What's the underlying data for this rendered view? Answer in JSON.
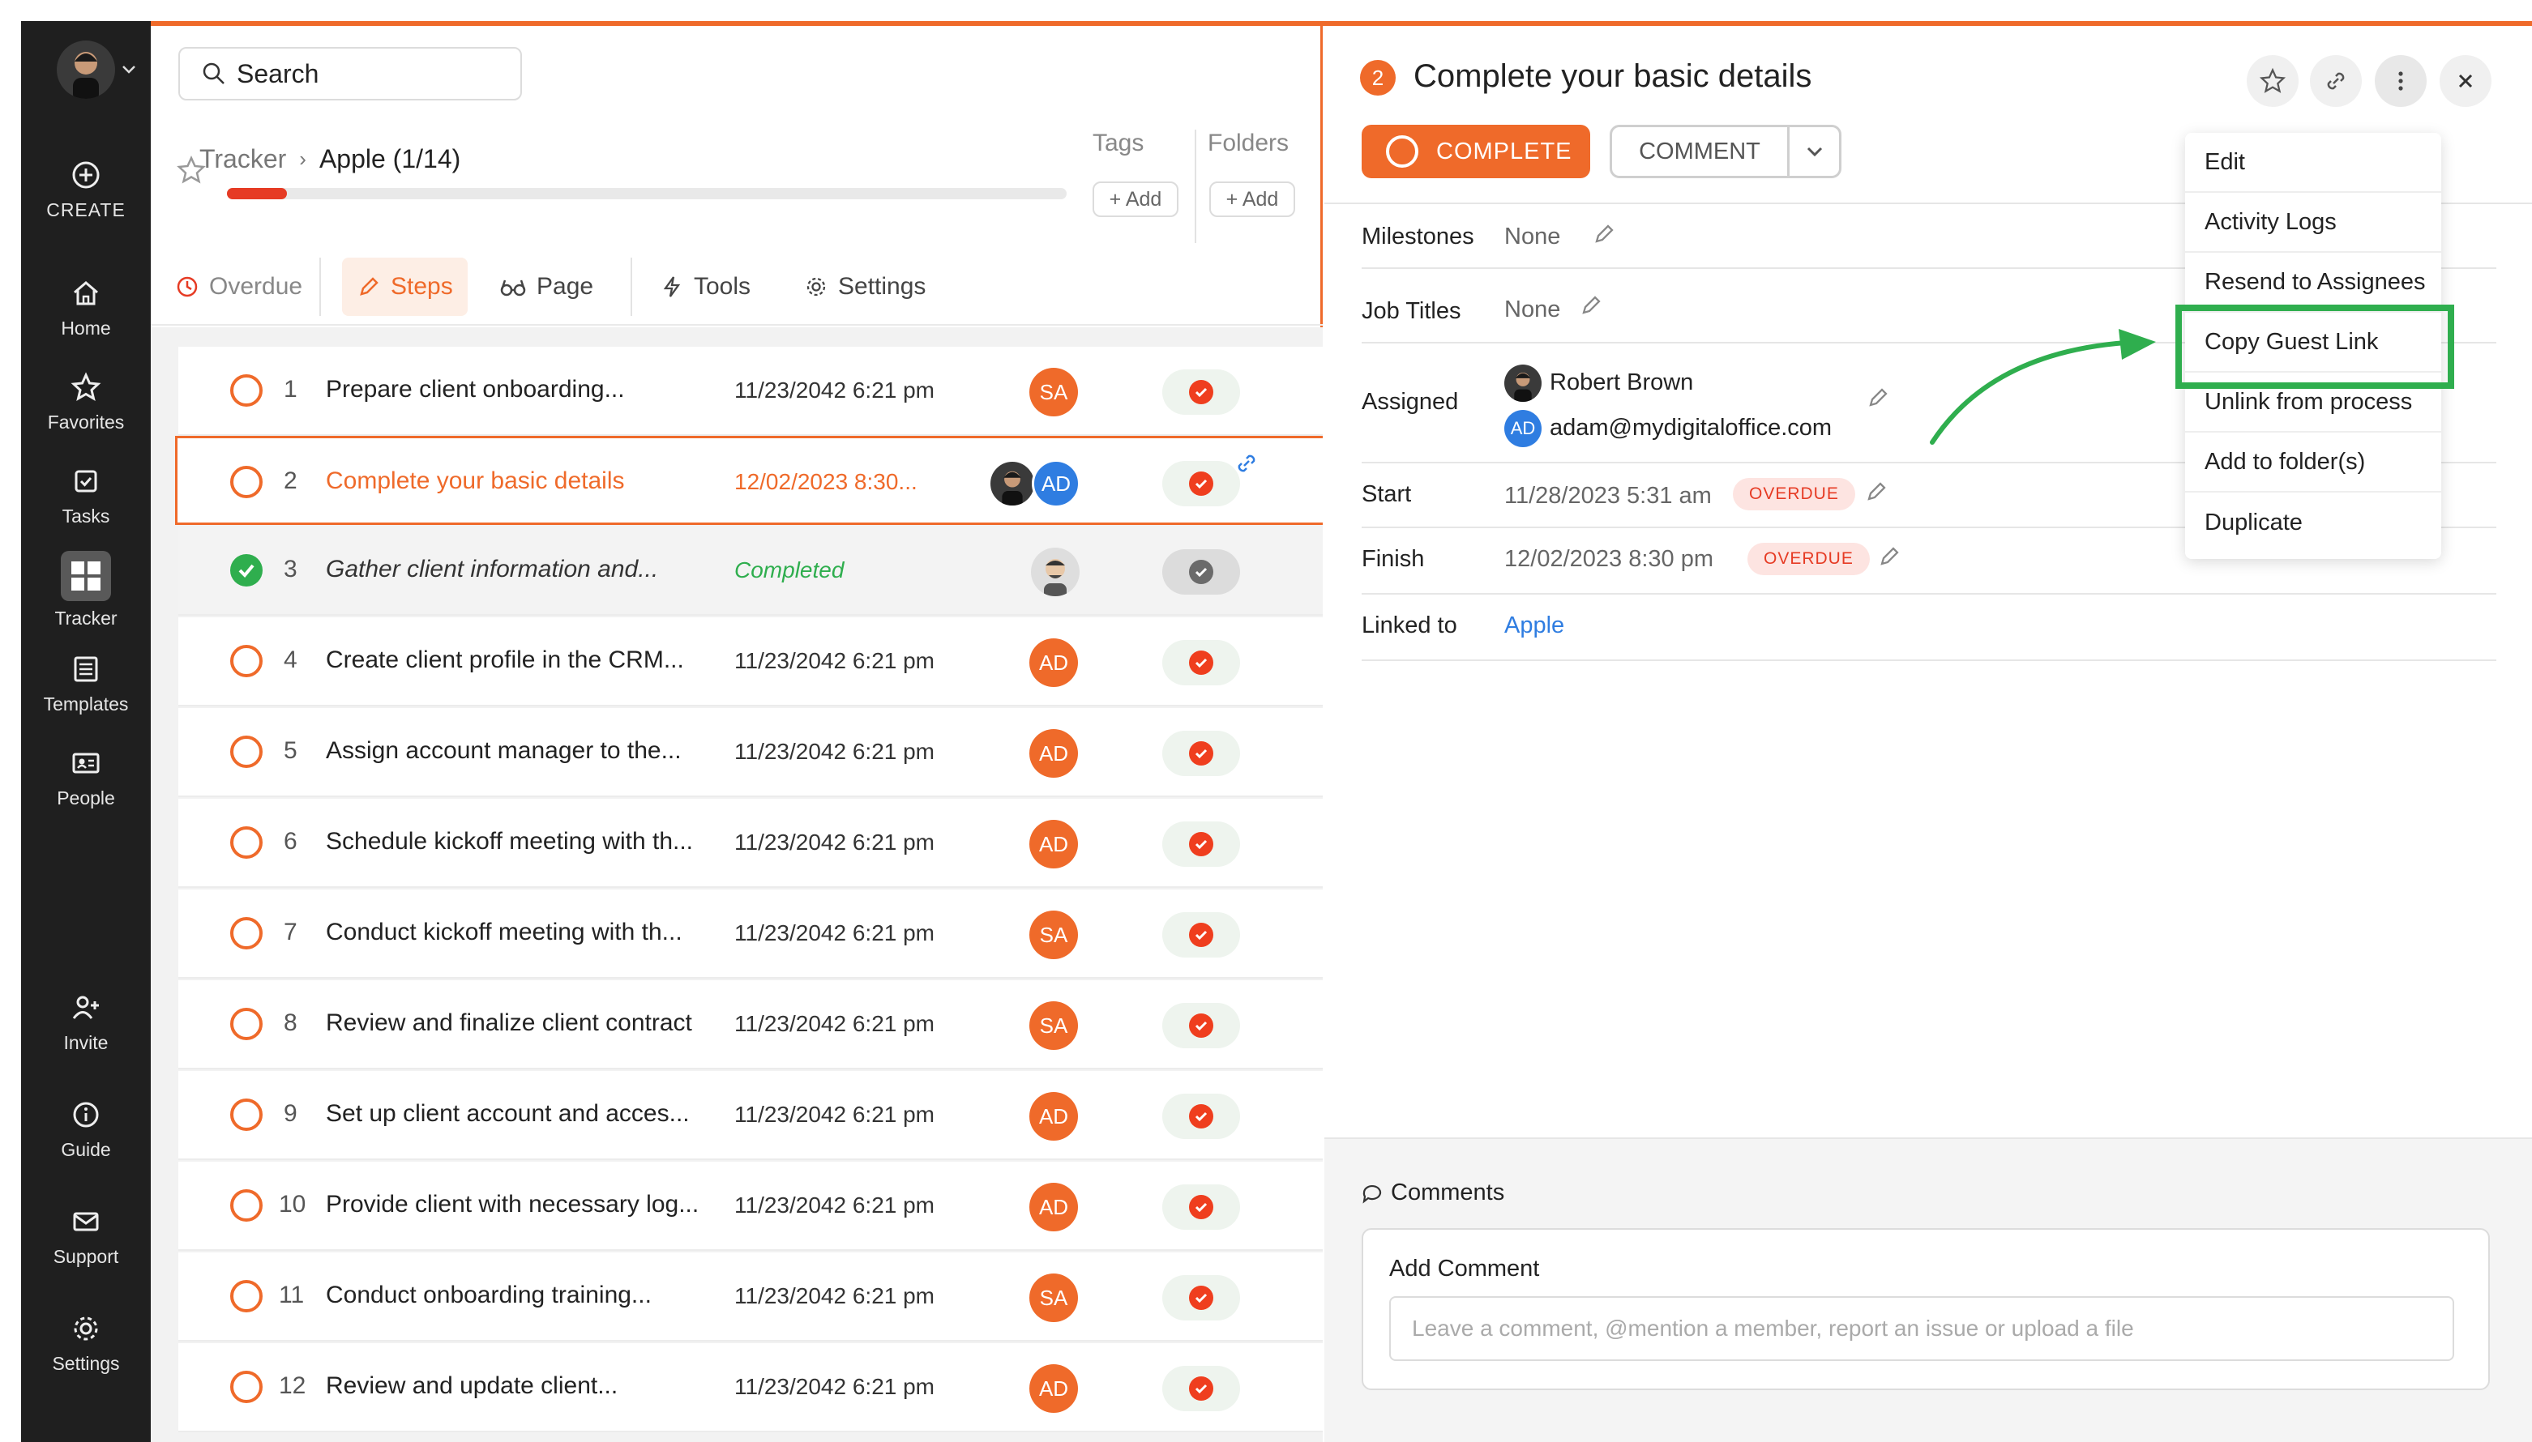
{
  "sidebar": {
    "create": "CREATE",
    "items": [
      {
        "label": "Home",
        "icon": "home-icon"
      },
      {
        "label": "Favorites",
        "icon": "star-icon"
      },
      {
        "label": "Tasks",
        "icon": "checkbox-icon"
      },
      {
        "label": "Tracker",
        "icon": "grid-icon",
        "active": true
      },
      {
        "label": "Templates",
        "icon": "template-icon"
      },
      {
        "label": "People",
        "icon": "id-card-icon"
      }
    ],
    "bottom": [
      {
        "label": "Invite",
        "icon": "add-user-icon"
      },
      {
        "label": "Guide",
        "icon": "info-icon"
      },
      {
        "label": "Support",
        "icon": "mail-icon"
      },
      {
        "label": "Settings",
        "icon": "gear-icon"
      }
    ]
  },
  "left": {
    "search_placeholder": "Search",
    "breadcrumb": {
      "root": "Tracker",
      "current": "Apple (1/14)"
    },
    "tags_label": "Tags",
    "folders_label": "Folders",
    "add_label": "+ Add",
    "tabs": [
      "Overdue",
      "Steps",
      "Page",
      "Tools",
      "Settings"
    ],
    "steps": [
      {
        "n": "1",
        "title": "Prepare client onboarding...",
        "date": "11/23/2042 6:21 pm",
        "assignee": "SA"
      },
      {
        "n": "2",
        "title": "Complete your basic details",
        "date": "12/02/2023 8:30...",
        "assignee": "AD"
      },
      {
        "n": "3",
        "title": "Gather client information and...",
        "date": "Completed",
        "assignee": ""
      },
      {
        "n": "4",
        "title": "Create client profile in the CRM...",
        "date": "11/23/2042 6:21 pm",
        "assignee": "AD"
      },
      {
        "n": "5",
        "title": "Assign account manager to the...",
        "date": "11/23/2042 6:21 pm",
        "assignee": "AD"
      },
      {
        "n": "6",
        "title": "Schedule kickoff meeting with th...",
        "date": "11/23/2042 6:21 pm",
        "assignee": "AD"
      },
      {
        "n": "7",
        "title": "Conduct kickoff meeting with th...",
        "date": "11/23/2042 6:21 pm",
        "assignee": "SA"
      },
      {
        "n": "8",
        "title": "Review and finalize client contract",
        "date": "11/23/2042 6:21 pm",
        "assignee": "SA"
      },
      {
        "n": "9",
        "title": "Set up client account and acces...",
        "date": "11/23/2042 6:21 pm",
        "assignee": "AD"
      },
      {
        "n": "10",
        "title": "Provide client with necessary log...",
        "date": "11/23/2042 6:21 pm",
        "assignee": "AD"
      },
      {
        "n": "11",
        "title": "Conduct onboarding training...",
        "date": "11/23/2042 6:21 pm",
        "assignee": "SA"
      },
      {
        "n": "12",
        "title": "Review and update client...",
        "date": "11/23/2042 6:21 pm",
        "assignee": "AD"
      }
    ]
  },
  "detail": {
    "step_number": "2",
    "title": "Complete your basic details",
    "complete_label": "COMPLETE",
    "comment_label": "COMMENT",
    "fields": {
      "milestones_label": "Milestones",
      "milestones_value": "None",
      "job_titles_label": "Job Titles",
      "job_titles_value": "None",
      "assigned_label": "Assigned",
      "assignee_1": "Robert Brown",
      "assignee_2_initials": "AD",
      "assignee_2": "adam@mydigitaloffice.com",
      "start_label": "Start",
      "start_value": "11/28/2023 5:31 am",
      "finish_label": "Finish",
      "finish_value": "12/02/2023 8:30 pm",
      "overdue_badge": "OVERDUE",
      "linked_label": "Linked to",
      "linked_value": "Apple"
    },
    "comments_title": "Comments",
    "add_comment_label": "Add Comment",
    "comment_placeholder": "Leave a comment, @mention a member, report an issue or upload a file"
  },
  "menu": {
    "items": [
      "Edit",
      "Activity Logs",
      "Resend to Assignees",
      "Copy Guest Link",
      "Unlink from process",
      "Add to folder(s)",
      "Duplicate"
    ]
  },
  "colors": {
    "accent": "#ef6a2a",
    "highlight": "#2fae4e",
    "link": "#2f7de1",
    "overdue": "#e63b24"
  }
}
